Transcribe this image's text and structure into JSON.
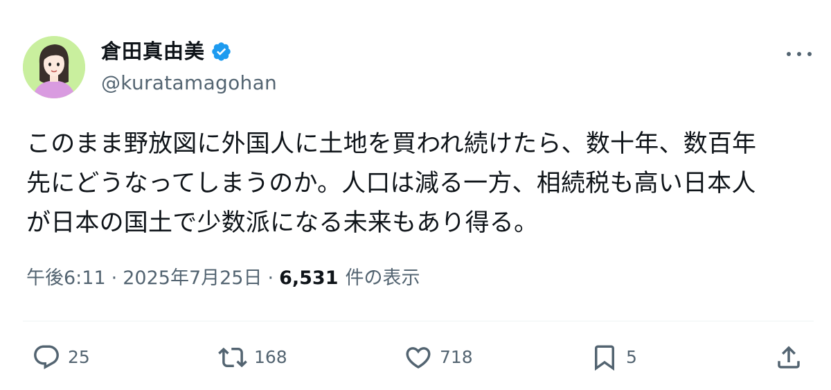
{
  "author": {
    "display_name": "倉田真由美",
    "handle": "@kuratamagohan",
    "verified": true,
    "avatar_bg": "#c9ef9e"
  },
  "tweet": {
    "lines": [
      "このまま野放図に外国人に土地を買われ続けたら、数十年、数百年",
      "先にどうなってしまうのか。人口は減る一方、相続税も高い日本人",
      "が日本の国土で少数派になる未来もあり得る。"
    ]
  },
  "meta": {
    "time": "午後6:11",
    "separator": "·",
    "date": "2025年7月25日",
    "views_count": "6,531",
    "views_label": "件の表示"
  },
  "actions": {
    "reply_count": "25",
    "retweet_count": "168",
    "like_count": "718",
    "bookmark_count": "5"
  },
  "colors": {
    "text": "#0f1419",
    "secondary": "#536471",
    "verified": "#1d9bf0",
    "divider": "#eff3f4"
  },
  "icons": [
    "verified-badge-icon",
    "more-icon",
    "reply-icon",
    "retweet-icon",
    "like-icon",
    "bookmark-icon",
    "share-icon"
  ]
}
